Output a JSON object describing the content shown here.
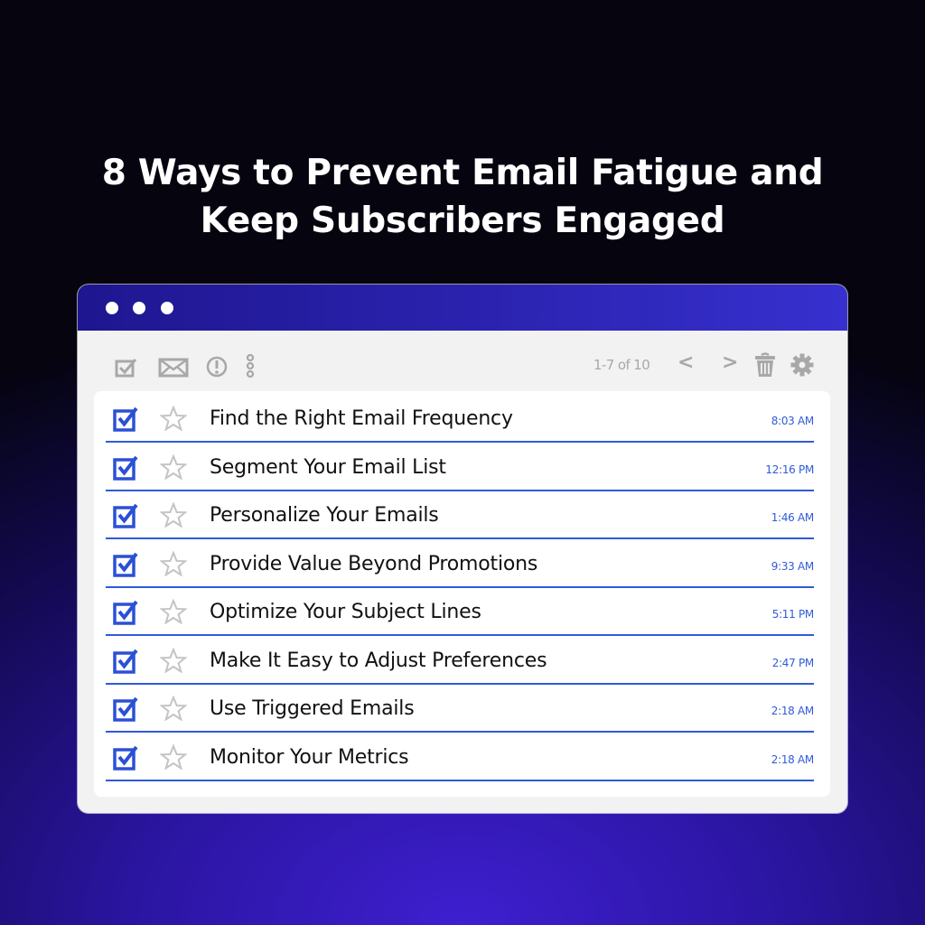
{
  "headline": {
    "line1": "8 Ways to Prevent Email Fatigue and",
    "line2": "Keep Subscribers Engaged"
  },
  "window": {
    "titlebar_dots": 3,
    "colors": {
      "titlebar_accent": "#2a22ad",
      "link_blue": "#2f5bd8",
      "icon_gray": "#a8a8a8"
    }
  },
  "toolbar": {
    "left_icons": [
      "select-all-icon",
      "mail-icon",
      "alert-icon",
      "more-vertical-icon"
    ],
    "pager_text": "1-7 of 10",
    "prev_label": "<",
    "next_label": ">",
    "right_icons": [
      "trash-icon",
      "gear-icon"
    ]
  },
  "emails": [
    {
      "subject": "Find the Right Email Frequency",
      "time": "8:03 AM",
      "checked": true,
      "starred": false
    },
    {
      "subject": "Segment Your Email List",
      "time": "12:16 PM",
      "checked": true,
      "starred": false
    },
    {
      "subject": "Personalize Your Emails",
      "time": "1:46 AM",
      "checked": true,
      "starred": false
    },
    {
      "subject": "Provide Value Beyond Promotions",
      "time": "9:33 AM",
      "checked": true,
      "starred": false
    },
    {
      "subject": "Optimize Your Subject Lines",
      "time": "5:11 PM",
      "checked": true,
      "starred": false
    },
    {
      "subject": "Make It Easy to Adjust Preferences",
      "time": "2:47 PM",
      "checked": true,
      "starred": false
    },
    {
      "subject": "Use Triggered Emails",
      "time": "2:18 AM",
      "checked": true,
      "starred": false
    },
    {
      "subject": "Monitor Your Metrics",
      "time": "2:18 AM",
      "checked": true,
      "starred": false
    }
  ]
}
